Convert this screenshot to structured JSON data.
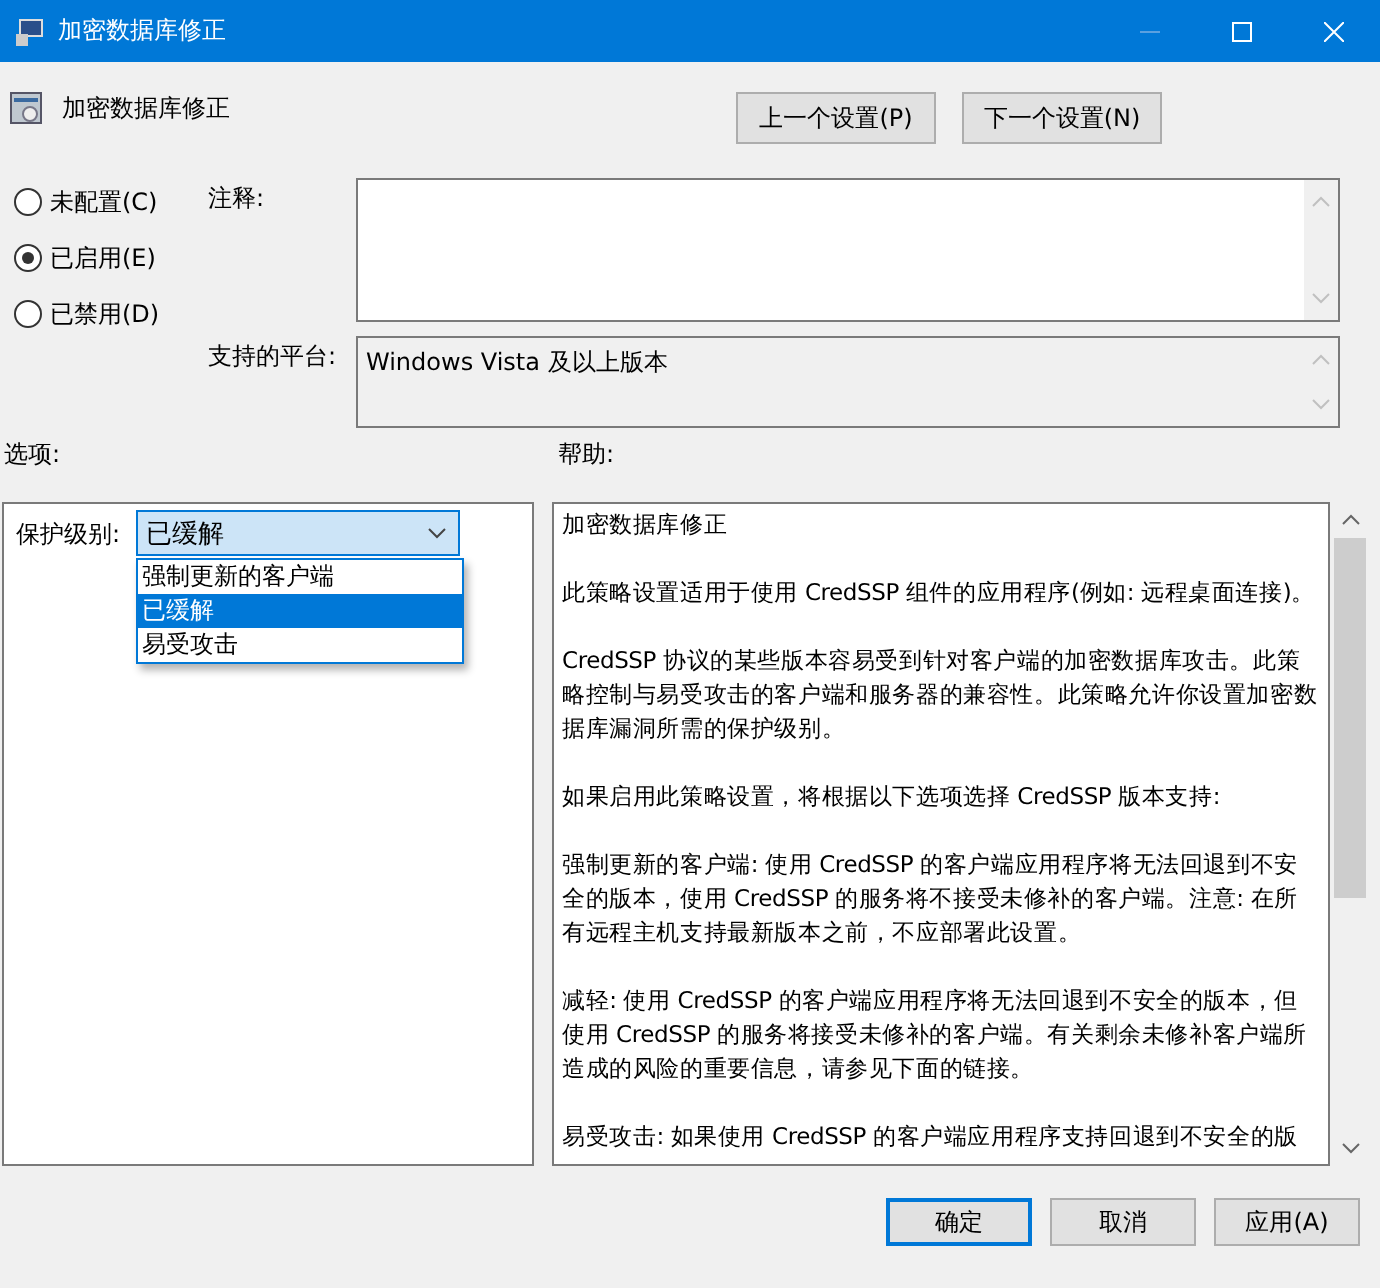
{
  "window": {
    "title": "加密数据库修正"
  },
  "heading": "加密数据库修正",
  "nav_buttons": [
    "上一个设置(P)",
    "下一个设置(N)"
  ],
  "state_options": [
    {
      "label": "未配置(C)",
      "selected": false
    },
    {
      "label": "已启用(E)",
      "selected": true
    },
    {
      "label": "已禁用(D)",
      "selected": false
    }
  ],
  "comment": {
    "label": "注释:"
  },
  "platform": {
    "label": "支持的平台:",
    "value": "Windows Vista 及以上版本"
  },
  "options_label": "选项:",
  "help_label": "帮助:",
  "protection": {
    "label": "保护级别:",
    "value": "已缓解",
    "expanded": true,
    "items": [
      {
        "label": "强制更新的客户端",
        "selected": false
      },
      {
        "label": "已缓解",
        "selected": true
      },
      {
        "label": "易受攻击",
        "selected": false
      }
    ]
  },
  "help_paragraphs": [
    [
      "加密数据库修正"
    ],
    [
      "此策略设置适用于使用 CredSSP 组件的应用程序(例如: 远程桌面连接)。"
    ],
    [
      "CredSSP 协议的某些版本容易受到针对客户端的加密数据库攻击。此策",
      "略控制与易受攻击的客户端和服务器的兼容性。此策略允许你设置加密数",
      "据库漏洞所需的保护级别。"
    ],
    [
      "如果启用此策略设置，将根据以下选项选择 CredSSP 版本支持:"
    ],
    [
      "强制更新的客户端: 使用 CredSSP 的客户端应用程序将无法回退到不安",
      "全的版本，使用 CredSSP 的服务将不接受未修补的客户端。注意: 在所",
      "有远程主机支持最新版本之前，不应部署此设置。"
    ],
    [
      "减轻: 使用 CredSSP 的客户端应用程序将无法回退到不安全的版本，但",
      "使用 CredSSP 的服务将接受未修补的客户端。有关剩余未修补客户端所",
      "造成的风险的重要信息，请参见下面的链接。"
    ],
    [
      "易受攻击: 如果使用 CredSSP 的客户端应用程序支持回退到不安全的版"
    ]
  ],
  "footer_buttons": [
    {
      "label": "确定",
      "kind": "default"
    },
    {
      "label": "取消",
      "kind": "normal"
    },
    {
      "label": "应用(A)",
      "kind": "normal"
    }
  ]
}
